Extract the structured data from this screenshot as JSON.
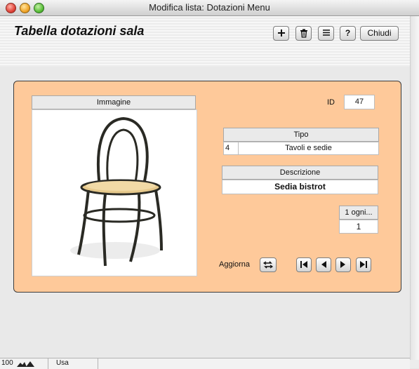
{
  "window": {
    "title": "Modifica lista: Dotazioni Menu"
  },
  "header": {
    "title": "Tabella dotazioni sala"
  },
  "toolbar": {
    "add_icon": "plus-icon",
    "delete_icon": "trash-icon",
    "list_icon": "list-icon",
    "help_label": "?",
    "close_label": "Chiudi"
  },
  "record": {
    "image_header": "Immagine",
    "image_icon": "chair-photo",
    "id_label": "ID",
    "id_value": "47",
    "tipo_header": "Tipo",
    "tipo_code": "4",
    "tipo_value": "Tavoli e sedie",
    "descrizione_header": "Descrizione",
    "descrizione_value": "Sedia bistrot",
    "ogni_label": "1 ogni...",
    "ogni_value": "1"
  },
  "navigation": {
    "refresh_label": "Aggiorna",
    "refresh_icon": "refresh-arrows-icon",
    "first_icon": "first-record-icon",
    "prev_icon": "previous-record-icon",
    "next_icon": "next-record-icon",
    "last_icon": "last-record-icon"
  },
  "status": {
    "zoom": "100",
    "mode": "Usa"
  },
  "colors": {
    "panel": "#fec99a"
  }
}
